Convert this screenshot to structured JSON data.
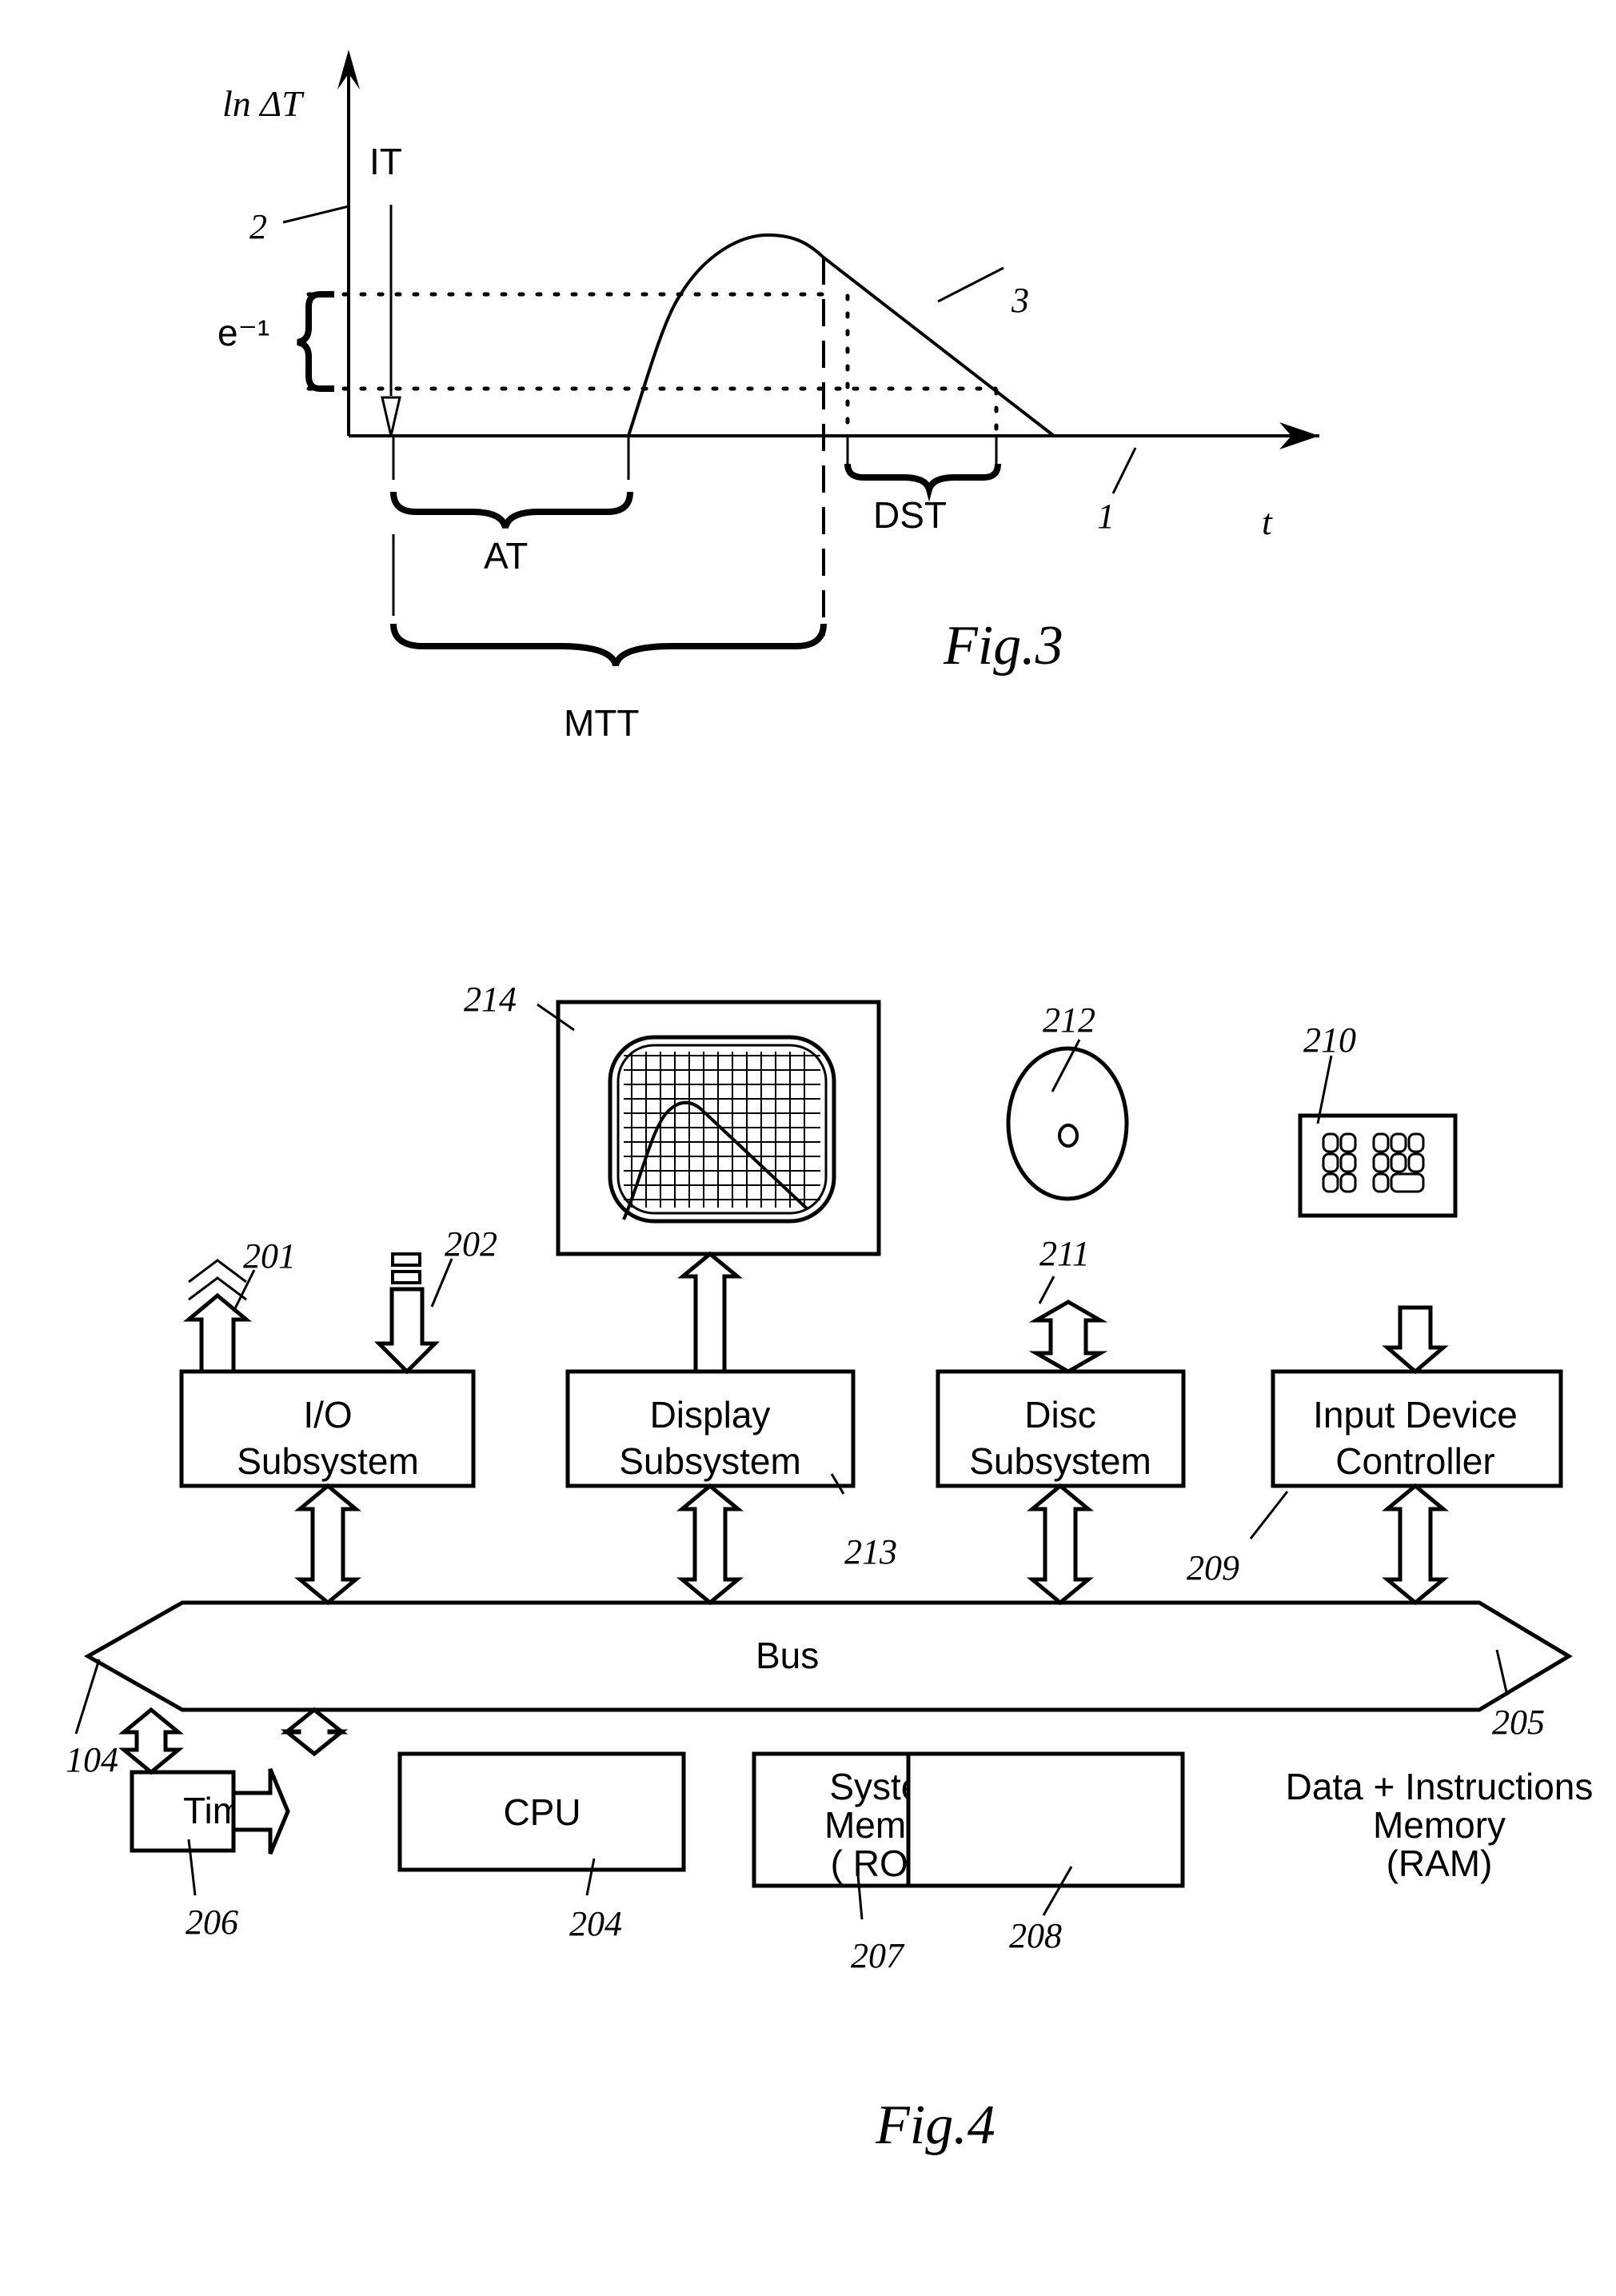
{
  "fig3": {
    "caption": "Fig.3",
    "y_axis_label": "ln ΔT",
    "x_axis_label": "t",
    "labels": {
      "it": "IT",
      "e_inv": "e⁻¹",
      "at": "AT",
      "mtt": "MTT",
      "dst": "DST"
    },
    "refs": {
      "x_axis": "1",
      "y_axis": "2",
      "curve": "3"
    }
  },
  "fig4": {
    "caption": "Fig.4",
    "bus": {
      "label": "Bus",
      "ref_left": "104",
      "ref_right": "205"
    },
    "blocks": {
      "io": {
        "line1": "I/O",
        "line2": "Subsystem"
      },
      "display": {
        "line1": "Display",
        "line2": "Subsystem",
        "ref": "213"
      },
      "disc": {
        "line1": "Disc",
        "line2": "Subsystem",
        "ref": "211"
      },
      "input": {
        "line1": "Input Device",
        "line2": "Controller",
        "ref": "209"
      },
      "timer": {
        "line1": "Timer",
        "ref": "206"
      },
      "cpu": {
        "line1": "CPU",
        "ref": "204"
      },
      "rom": {
        "line1": "System",
        "line2": "Memory",
        "line3": "( ROM)",
        "ref": "207"
      },
      "ram": {
        "line1": "Data + Instructions",
        "line2": "Memory",
        "line3": "(RAM)",
        "ref": "208"
      }
    },
    "devices": {
      "io_out_ref": "201",
      "io_in_ref": "202",
      "monitor_ref": "214",
      "disc_ref": "212",
      "keypad_ref": "210"
    }
  }
}
